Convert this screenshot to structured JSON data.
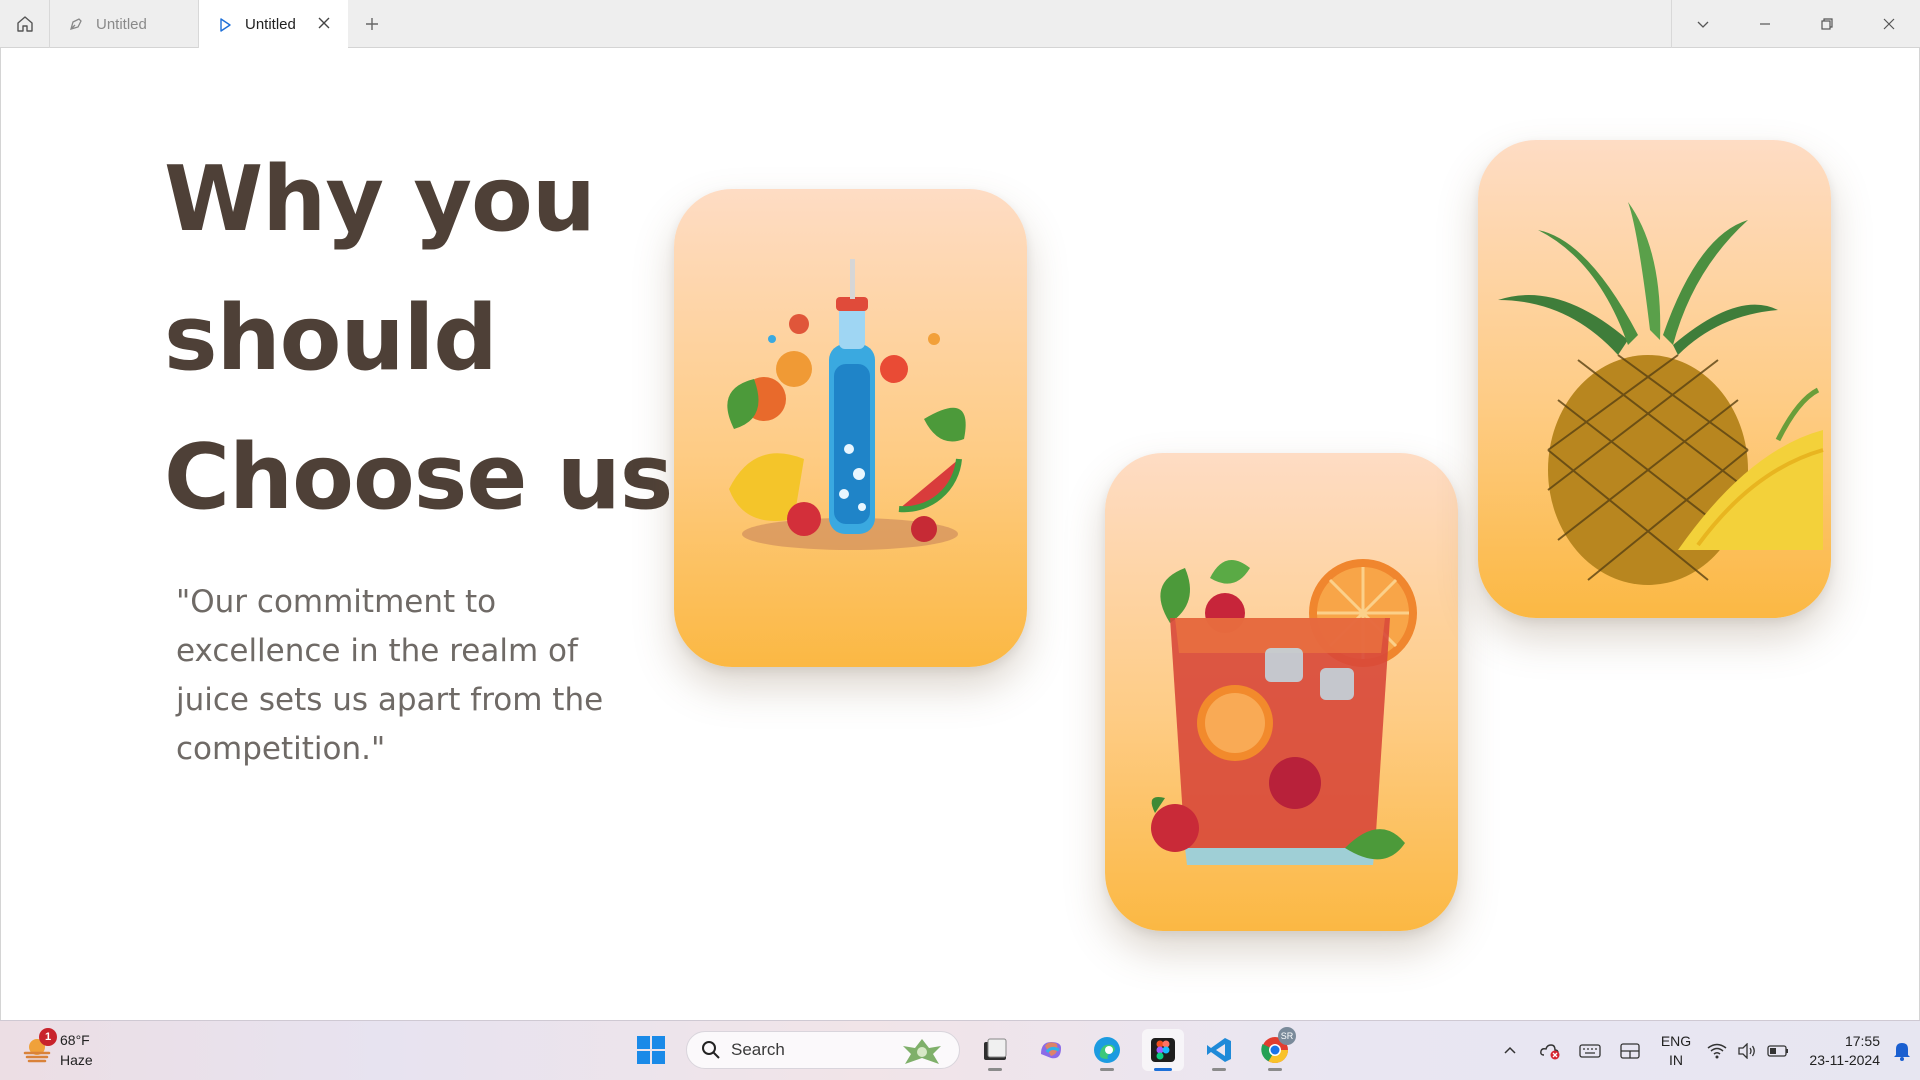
{
  "tabs": [
    {
      "label": "Untitled",
      "active": false,
      "icon": "figma-pen-icon"
    },
    {
      "label": "Untitled",
      "active": true,
      "icon": "play-icon"
    }
  ],
  "canvas": {
    "headline_lines": [
      "Why you",
      "should",
      "Choose us?"
    ],
    "quote": "\"Our commitment to excellence in the realm of juice sets us apart from the competition.\"",
    "cards": [
      {
        "image": "fruit-bottle-illustration"
      },
      {
        "image": "citrus-drink-glass-illustration"
      },
      {
        "image": "pineapple-illustration"
      }
    ],
    "colors": {
      "headline": "#4e4037",
      "card_top": "#fedcc4",
      "card_bottom": "#fbb843"
    }
  },
  "taskbar": {
    "weather": {
      "temp": "68°F",
      "condition": "Haze",
      "badge": "1"
    },
    "search_placeholder": "Search",
    "apps": [
      "file-explorer-icon",
      "copilot-icon",
      "edge-icon",
      "figma-icon",
      "vscode-icon",
      "chrome-icon"
    ],
    "chrome_badge": "SR",
    "language": {
      "line1": "ENG",
      "line2": "IN"
    },
    "clock": {
      "time": "17:55",
      "date": "23-11-2024"
    }
  }
}
